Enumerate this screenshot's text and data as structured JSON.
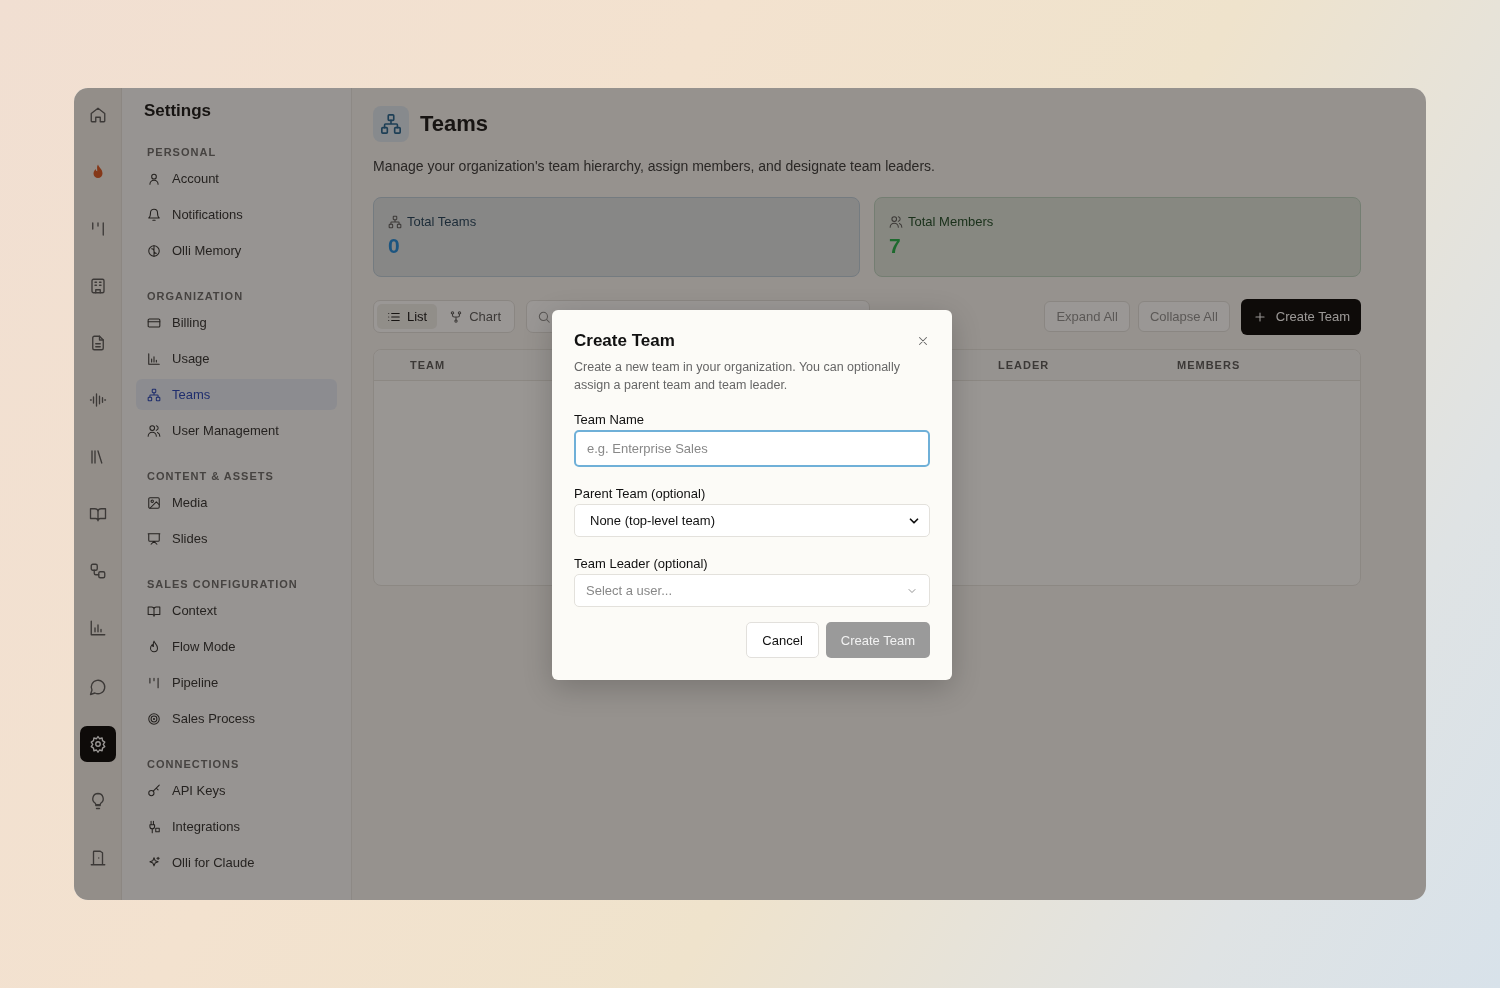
{
  "rail": {
    "top": [
      {
        "selected": false
      },
      {
        "selected": false
      },
      {
        "selected": false
      },
      {
        "selected": false
      },
      {
        "selected": false
      },
      {
        "selected": false
      },
      {
        "selected": false
      },
      {
        "selected": false
      },
      {
        "selected": false
      },
      {
        "selected": false
      }
    ],
    "bottom": [
      {
        "selected": false
      },
      {
        "selected": true
      },
      {
        "selected": false
      },
      {
        "selected": false
      }
    ]
  },
  "sidebar": {
    "title": "Settings",
    "sections": [
      {
        "heading": "PERSONAL",
        "items": [
          {
            "label": "Account",
            "selected": false
          },
          {
            "label": "Notifications",
            "selected": false
          },
          {
            "label": "Olli Memory",
            "selected": false
          }
        ]
      },
      {
        "heading": "ORGANIZATION",
        "items": [
          {
            "label": "Billing",
            "selected": false
          },
          {
            "label": "Usage",
            "selected": false
          },
          {
            "label": "Teams",
            "selected": true
          },
          {
            "label": "User Management",
            "selected": false
          }
        ]
      },
      {
        "heading": "CONTENT & ASSETS",
        "items": [
          {
            "label": "Media",
            "selected": false
          },
          {
            "label": "Slides",
            "selected": false
          }
        ]
      },
      {
        "heading": "SALES CONFIGURATION",
        "items": [
          {
            "label": "Context",
            "selected": false
          },
          {
            "label": "Flow Mode",
            "selected": false
          },
          {
            "label": "Pipeline",
            "selected": false
          },
          {
            "label": "Sales Process",
            "selected": false
          }
        ]
      },
      {
        "heading": "CONNECTIONS",
        "items": [
          {
            "label": "API Keys",
            "selected": false
          },
          {
            "label": "Integrations",
            "selected": false
          },
          {
            "label": "Olli for Claude",
            "selected": false
          }
        ]
      }
    ]
  },
  "page": {
    "title": "Teams",
    "subtitle": "Manage your organization's team hierarchy, assign members, and designate team leaders."
  },
  "stats": [
    {
      "label": "Total Teams",
      "value": "0",
      "color": "#1c5580"
    },
    {
      "label": "Total Members",
      "value": "7",
      "color": "#1d6a2e"
    }
  ],
  "toolbar": {
    "views": [
      {
        "label": "List",
        "selected": true
      },
      {
        "label": "Chart",
        "selected": false
      }
    ],
    "actions": [
      {
        "label": "Expand All",
        "kind": "outline",
        "disabled": true
      },
      {
        "label": "Collapse All",
        "kind": "outline",
        "disabled": true
      },
      {
        "label": "Create Team",
        "kind": "primary",
        "disabled": false
      }
    ]
  },
  "table": {
    "columns": [
      "TEAM",
      "LEADER",
      "MEMBERS"
    ]
  },
  "modal": {
    "title": "Create Team",
    "description": "Create a new team in your organization. You can optionally assign a parent team and team leader.",
    "fields": [
      {
        "kind": "text",
        "label": "Team Name",
        "placeholder": "e.g. Enterprise Sales",
        "focused": true
      },
      {
        "kind": "select",
        "label": "Parent Team (optional)",
        "value": "None (top-level team)",
        "focused": false
      },
      {
        "kind": "combobox",
        "label": "Team Leader (optional)",
        "placeholder": "Select a user...",
        "focused": false
      }
    ],
    "buttons": [
      {
        "label": "Cancel",
        "kind": "outline",
        "disabled": false
      },
      {
        "label": "Create Team",
        "kind": "primary",
        "disabled": true
      }
    ]
  }
}
